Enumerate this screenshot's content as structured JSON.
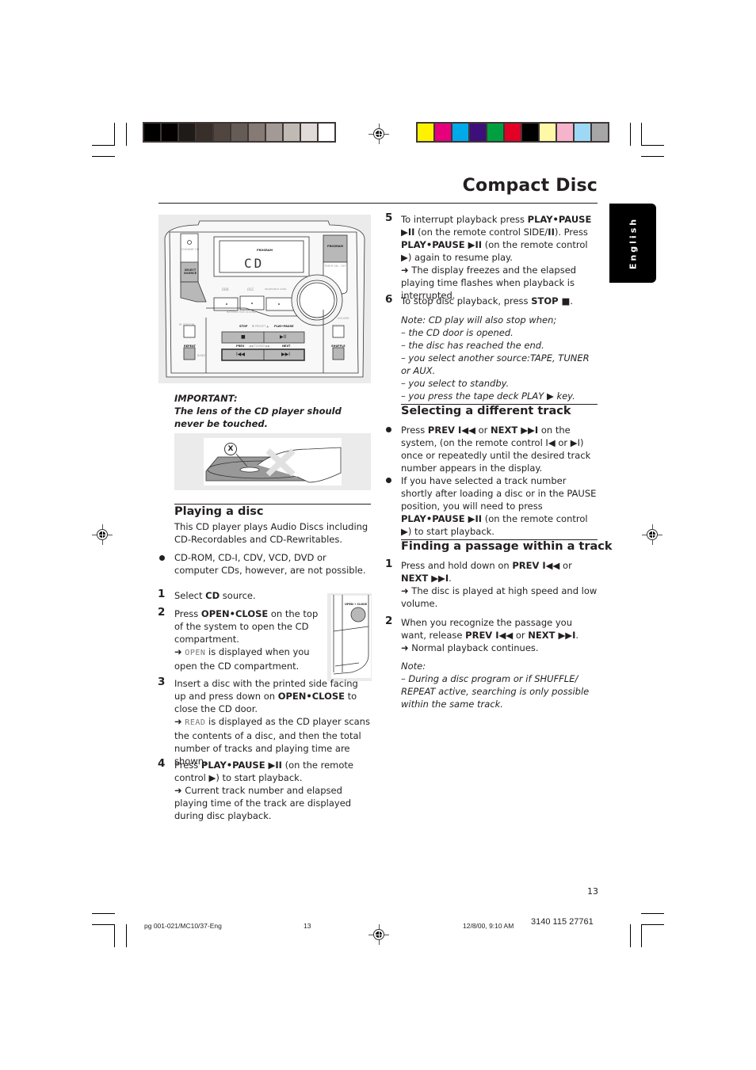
{
  "print_marks": {
    "grayscale_swatches": [
      "#000000",
      "#040000",
      "#1f1b19",
      "#382e2a",
      "#51463f",
      "#665c56",
      "#857a74",
      "#a39a95",
      "#c1b9b4",
      "#e0dbd8",
      "#ffffff"
    ],
    "color_swatches": [
      "#fff200",
      "#e6007e",
      "#00a9e9",
      "#3c0f7a",
      "#00a040",
      "#e20026",
      "#000000",
      "#fff8a6",
      "#f6b3cc",
      "#9dd8f5",
      "#a6a6a6"
    ]
  },
  "header": {
    "title": "Compact Disc",
    "language_tab": "English"
  },
  "left": {
    "device_illustration": {
      "display_text": "CD",
      "labels": {
        "standby": "STANDBY ON",
        "select_source": "SELECT SOURCE",
        "program_display": "PROGRAM",
        "program_button": "PROGRAM",
        "timer": "TIMER ON - OFF",
        "dbb": "DBB",
        "dsc": "DSC",
        "incredible_surround": "INCREDIBLE SURR.",
        "interactive_sound": "INTERACTIVE SOUND",
        "volume": "VOLUME",
        "ir_sensor": "IR SENSOR",
        "clock": "CLOCK",
        "stop": "STOP",
        "preset": "▼ PRESET ▲",
        "play_pause": "PLAY•PAUSE",
        "stop_glyph": "■",
        "play_pause_glyph": "▶II",
        "repeat": "REPEAT",
        "band": "BAND",
        "prev": "PREV",
        "tuning": "◀◀ TUNING ▶▶",
        "next": "NEXT",
        "prev_glyph": "I◀◀",
        "next_glyph": "▶▶I",
        "shuffle": "SHUFFLE"
      }
    },
    "important": {
      "label": "IMPORTANT:",
      "text": "The lens of the CD player should never be touched.",
      "lens_marker": "X"
    },
    "playing": {
      "heading": "Playing a disc",
      "intro": "This CD player plays Audio Discs including CD-Recordables and CD-Rewritables.",
      "bullet": "CD-ROM, CD-I, CDV,  VCD, DVD or computer CDs, however, are not possible.",
      "open_close_label": "OPEN • CLOSE",
      "steps": [
        {
          "num": "1",
          "pre": "Select ",
          "bold": "CD",
          "post": " source."
        },
        {
          "num": "2",
          "pre": "Press ",
          "bold": "OPEN•CLOSE",
          "post": " on the top of the system to open the CD compartment.",
          "arrow": "➜",
          "seg": "OPEN",
          "result": " is displayed when you open the CD compartment."
        },
        {
          "num": "3",
          "pre": "Insert a disc with the printed side facing up and press down on ",
          "bold": "OPEN•CLOSE",
          "post": " to close the CD door.",
          "arrow": "➜",
          "seg": "READ",
          "result": " is displayed as the CD player scans the contents of a disc, and then the total number of tracks and playing time are shown."
        },
        {
          "num": "4",
          "pre": "Press ",
          "bold": "PLAY•PAUSE ▶II",
          "post": " (on the remote control ▶) to start playback.",
          "arrow": "➜",
          "result": " Current track number and elapsed playing time of the track are displayed during disc playback."
        }
      ]
    }
  },
  "right": {
    "steps": [
      {
        "num": "5",
        "p1": "To interrupt playback press ",
        "b1": "PLAY•PAUSE ▶II",
        "p2": " (on the remote control SIDE/",
        "b2": "II",
        "p3": "). Press ",
        "b3": "PLAY•PAUSE ▶II",
        "p4": " (on the remote control ▶) again to resume play.",
        "arrow": "➜",
        "result": " The display freezes and the elapsed playing time flashes when playback is interrupted."
      },
      {
        "num": "6",
        "pre": "To stop disc playback, press ",
        "bold": "STOP ■",
        "post": "."
      }
    ],
    "note": {
      "lines": [
        "Note: CD play will also stop when;",
        "– the CD door is opened.",
        "– the disc has reached the end.",
        "– you select another source:TAPE, TUNER or AUX.",
        "– you select to standby.",
        "– you press the tape deck PLAY ▶ key."
      ]
    },
    "selecting": {
      "heading": "Selecting a different track",
      "bullets": [
        {
          "p1": "Press ",
          "b1": "PREV I◀◀",
          "p2": " or ",
          "b2": "NEXT ▶▶I",
          "p3": " on the system, (on the remote control I◀ or ▶I) once or repeatedly until the desired track number appears in the display."
        },
        {
          "p1": "If you have selected a track number shortly after loading a disc or in the PAUSE position, you will need to press ",
          "b1": "PLAY•PAUSE ▶II",
          "p2": " (on the remote control ▶) to start playback."
        }
      ]
    },
    "finding": {
      "heading": "Finding a passage within a track",
      "steps": [
        {
          "num": "1",
          "p1": "Press and hold down on ",
          "b1": "PREV I◀◀",
          "p2": " or ",
          "b2": "NEXT ▶▶I",
          "p3": ".",
          "arrow": "➜",
          "result": " The disc is played at high speed and low volume."
        },
        {
          "num": "2",
          "p1": "When you recognize the passage you want, release ",
          "b1": "PREV I◀◀",
          "p2": " or ",
          "b2": "NEXT ▶▶I",
          "p3": ".",
          "arrow": "➜",
          "result": " Normal playback continues."
        }
      ],
      "note_label": "Note:",
      "note_text": "–  During a disc program or if SHUFFLE/ REPEAT active, searching is only possible within the same track."
    }
  },
  "footer": {
    "page_number": "13",
    "file_info": "pg 001-021/MC10/37-Eng",
    "slug_page": "13",
    "timestamp": "12/8/00, 9:10 AM",
    "product_code": "3140 115 27761"
  }
}
